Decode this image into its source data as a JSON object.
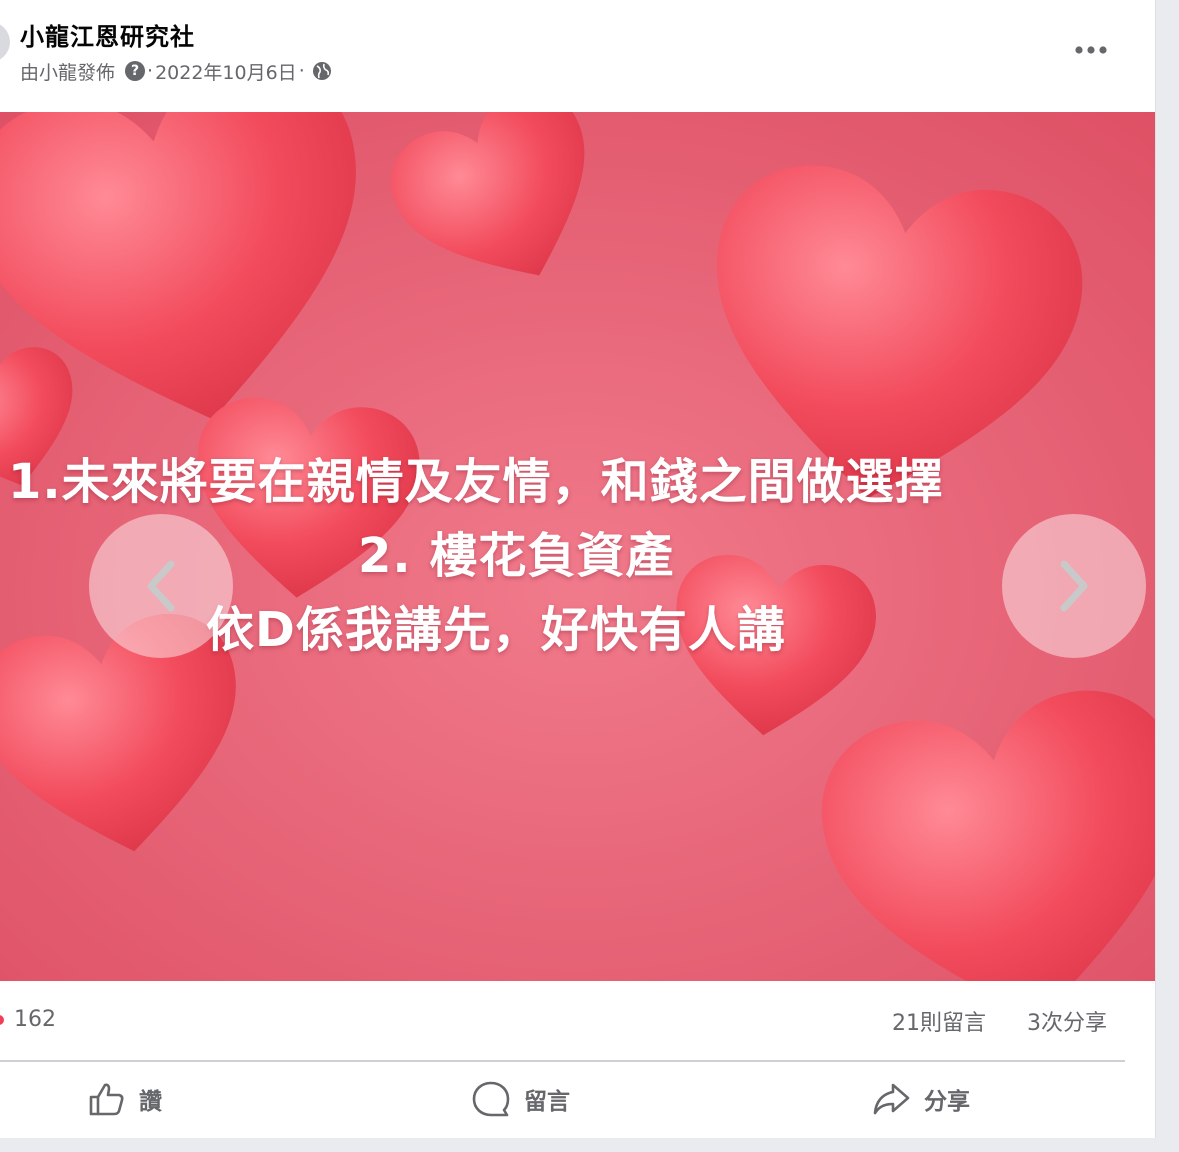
{
  "post": {
    "page_name": "小龍江恩研究社",
    "posted_by": "由小龍發佈",
    "help_icon": "?",
    "separator": "·",
    "date": "2022年10月6日",
    "audience_icon": "globe-icon",
    "more_icon": "more-dots-icon"
  },
  "photo": {
    "line1": "1.未來將要在親情及友情，和錢之間做選擇",
    "line2": "2. 樓花負資產",
    "line3": "依D係我講先，好快有人講",
    "background_color": "#e35b6e",
    "heart_color": "#f0505f"
  },
  "stats": {
    "reactions": "162",
    "comments": "21則留言",
    "shares": "3次分享"
  },
  "actions": {
    "like": "讚",
    "comment": "留言",
    "share": "分享"
  }
}
